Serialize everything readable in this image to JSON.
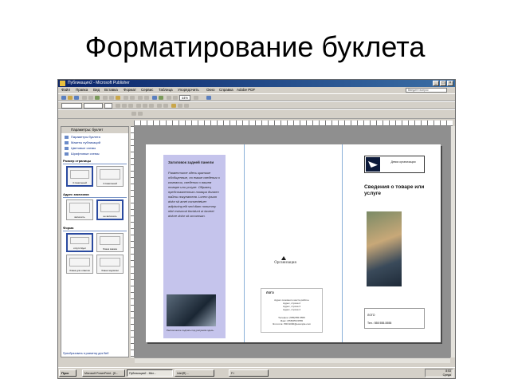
{
  "slide": {
    "title": "Форматирование буклета"
  },
  "window": {
    "title": "Публикация2 - Microsoft Publisher"
  },
  "menu": [
    "Файл",
    "Правка",
    "Вид",
    "Вставка",
    "Формат",
    "Сервис",
    "Таблица",
    "Упорядочить",
    "Окно",
    "Справка",
    "Adobe PDF"
  ],
  "help_placeholder": "Введите вопрос",
  "zoom": "44%",
  "taskpane": {
    "header": "Параметры: буклет",
    "items": [
      "Параметры буклета",
      "Макеты публикаций",
      "Цветовые схемы",
      "Шрифтовые схемы"
    ],
    "page_size_label": "Размер страницы",
    "page_sizes": [
      "3 панельный",
      "4 панельный"
    ],
    "customer_address_label": "Адрес заказчика",
    "address_options": [
      "включить",
      "не включать"
    ],
    "form_label": "Форма",
    "form_options": [
      "отсутствует",
      "бланк заказа",
      "бланк для ответов",
      "бланк подписки"
    ],
    "bottom_link": "Преобразовать в разметку для Веб"
  },
  "brochure": {
    "left_heading": "Заголовок задней панели",
    "left_body": "Разместите здесь краткие обобщенные, но емкие сведения о компании, сведения о вашем товаре или услуге. Образец представленного товара должен найти покупателя. Lorem ipsum dolor sit amet consectetuer adipiscing elit sed diam nonummy nibh euismod tincidunt ut laoreet dolore dolor sit accumsan.",
    "left_caption": "Расположите подпись под рисунком здесь.",
    "org_name": "Организация",
    "address_title": "ЛОГО",
    "address_lines": [
      "Адрес основного места работы",
      "Адрес, строка 2",
      "Адрес, строка 3",
      "Адрес, строка 4",
      "",
      "Телефон: (555)555-5555",
      "Факс: (555)555-5555",
      "Эл.почта: PRO1000@example.com"
    ],
    "right_org": "Девиз организации",
    "right_title": "Сведения о товаре или услуге",
    "right_box_line1": "ЛОГО",
    "right_box_line2": "Тел.: 555 555-5555"
  },
  "taskbar": {
    "start": "Пуск",
    "buttons": [
      "Microsoft PowerPoint - [Б...",
      "Публикация2 - Micr...",
      "Intel(R) ...",
      "F:\\"
    ],
    "clock": "8:53",
    "date": "Среда"
  }
}
